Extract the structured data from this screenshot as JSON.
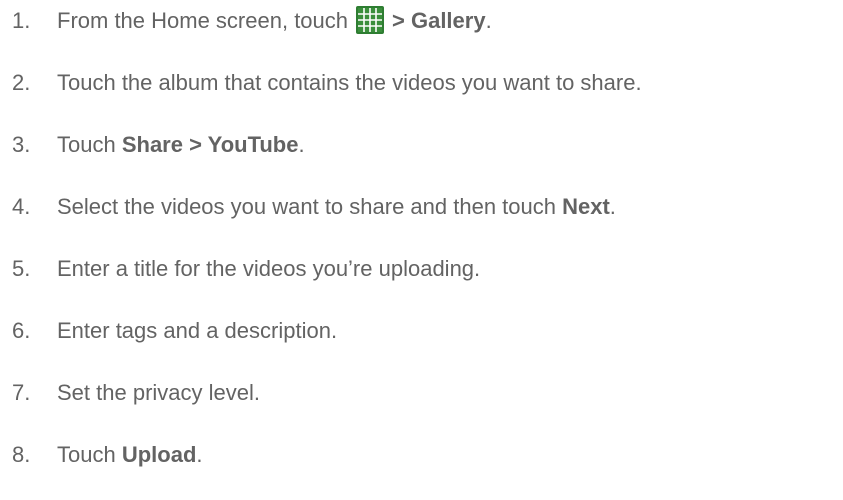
{
  "steps": [
    {
      "num": "1.",
      "text_before": "From the Home screen, touch",
      "icon": "apps-grid-icon",
      "bold": "> Gallery",
      "text_after": "."
    },
    {
      "num": "2.",
      "text": "Touch the album that contains the videos you want to share."
    },
    {
      "num": "3.",
      "text_before": "Touch ",
      "bold": "Share > YouTube",
      "text_after": "."
    },
    {
      "num": "4.",
      "text_before": "Select the videos you want to share and then touch ",
      "bold": "Next",
      "text_after": "."
    },
    {
      "num": "5.",
      "text": "Enter a title for the videos you’re uploading."
    },
    {
      "num": "6.",
      "text": "Enter tags and a description."
    },
    {
      "num": "7.",
      "text": "Set the privacy level."
    },
    {
      "num": "8.",
      "text_before": "Touch ",
      "bold": "Upload",
      "text_after": "."
    }
  ],
  "colors": {
    "text": "#636363",
    "icon_fill": "#2e7d32",
    "icon_grid": "#ffffff"
  }
}
